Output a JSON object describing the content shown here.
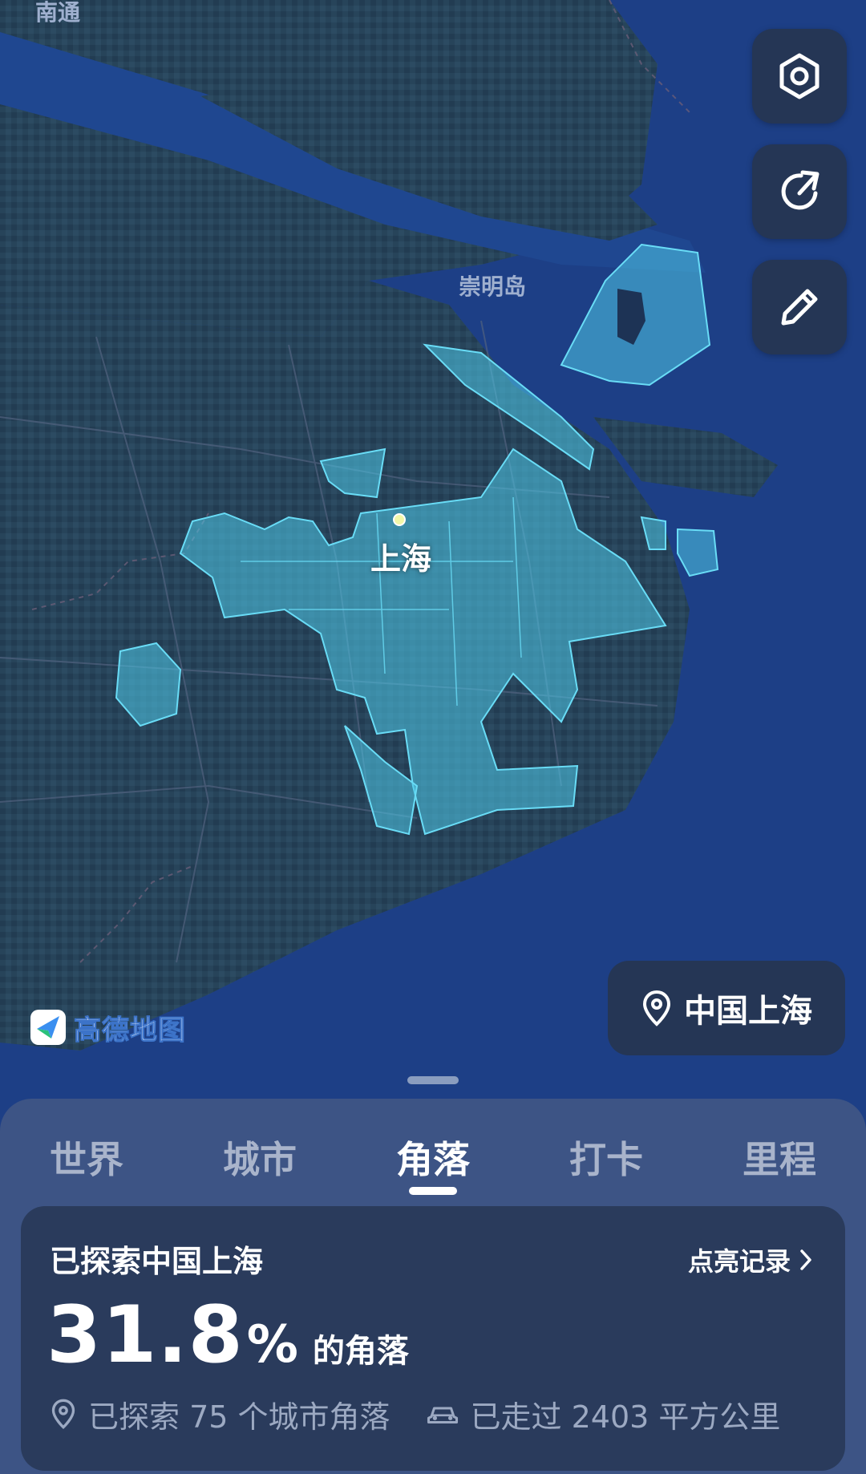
{
  "map": {
    "labels": {
      "top_left_fragment": "南通",
      "island": "崇明岛",
      "city": "上海"
    },
    "provider_logo_text": "高德地图",
    "accent_color": "#4fc9e8"
  },
  "side_buttons": [
    {
      "icon": "settings-hexagon-icon"
    },
    {
      "icon": "share-icon"
    },
    {
      "icon": "edit-pencil-icon"
    }
  ],
  "location_pill": {
    "label": "中国上海",
    "icon": "location-pin-icon"
  },
  "tabs": [
    {
      "label": "世界"
    },
    {
      "label": "城市"
    },
    {
      "label": "角落",
      "active": true
    },
    {
      "label": "打卡"
    },
    {
      "label": "里程"
    }
  ],
  "card": {
    "title": "已探索中国上海",
    "link_label": "点亮记录",
    "percent_value": "31.8",
    "percent_sign": "%",
    "percent_suffix": "的角落",
    "stat_corners": "已探索 75 个城市角落",
    "stat_area": "已走过 2403 平方公里"
  }
}
